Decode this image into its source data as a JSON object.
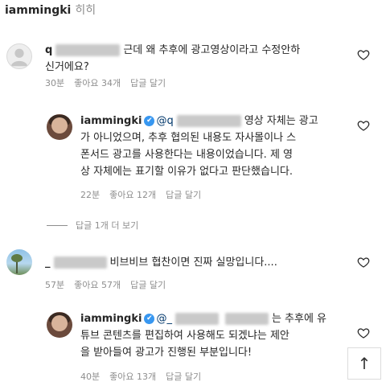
{
  "top": {
    "username": "iammingki",
    "text": "히히"
  },
  "comments": [
    {
      "username_prefix": "q",
      "text_line1": "근데 왜 추후에 광고영상이라고 수정안하",
      "text_line2": "신거에요?",
      "time": "30분",
      "likes": "좋아요 34개",
      "reply": "답글 달기"
    },
    {
      "username": "iammingki",
      "verified_mark": "✔",
      "mention_prefix": "@q",
      "text_line1_tail": "영상 자체는 광고",
      "text_line2": "가 아니었으며, 추후 협의된 내용도 자사몰이나 스",
      "text_line3": "폰서드 광고를 사용한다는 내용이었습니다. 제 영",
      "text_line4": "상 자체에는 표기할 이유가 없다고 판단했습니다.",
      "time": "22분",
      "likes": "좋아요 12개",
      "reply": "답글 달기"
    },
    {
      "username_prefix": "_",
      "text_line1": "비브비브 협찬이면 진짜 실망입니다....",
      "time": "57분",
      "likes": "좋아요 57개",
      "reply": "답글 달기"
    },
    {
      "username": "iammingki",
      "verified_mark": "✔",
      "mention_prefix": "@_",
      "text_line1_tail": "는 추후에 유",
      "text_line2": "튜브 콘텐츠를 편집하여 사용해도 되겠냐는 제안",
      "text_line3": "을 받아들여 광고가 진행된 부분입니다!",
      "time": "40분",
      "likes": "좋아요 13개",
      "reply": "답글 달기"
    }
  ],
  "view_replies": "답글 1개 더 보기",
  "scroll_top_glyph": "↑"
}
